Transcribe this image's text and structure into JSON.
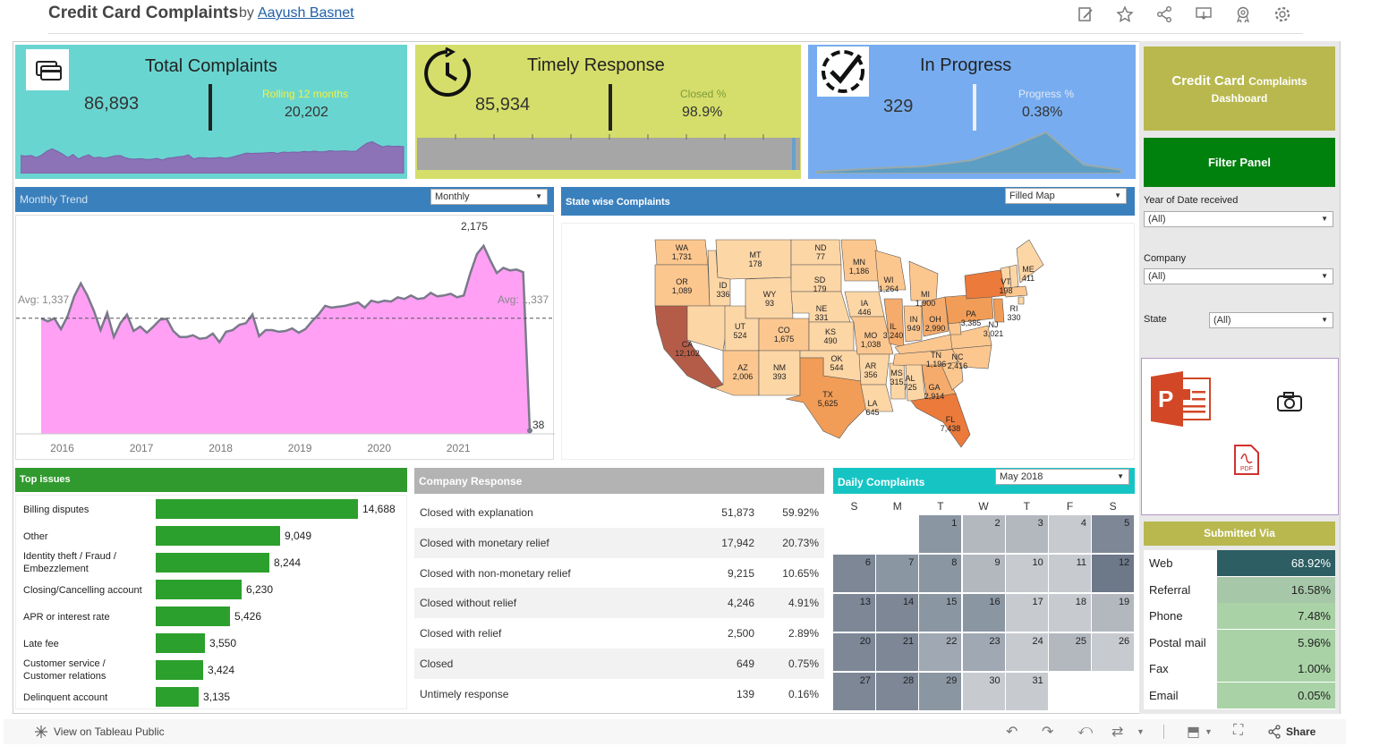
{
  "header": {
    "title": "Credit Card Complaints",
    "by": "by",
    "author": "Aayush Basnet",
    "icons": [
      "edit-icon",
      "star-icon",
      "share-icon",
      "comment-icon",
      "badge-icon",
      "gear-icon"
    ]
  },
  "kpis": {
    "total": {
      "title": "Total Complaints",
      "value": "86,893",
      "sub_label": "Rolling 12 months",
      "sub_value": "20,202",
      "bg": "#69d5d0",
      "spark_color": "#8c72b7"
    },
    "timely": {
      "title": "Timely  Response",
      "value": "85,934",
      "sub_label": "Closed %",
      "sub_value": "98.9%",
      "bg": "#d5de6a",
      "progress": 0.989
    },
    "progress": {
      "title": "In Progress",
      "value": "329",
      "sub_label": "Progress %",
      "sub_value": "0.38%",
      "bg": "#77adf0"
    }
  },
  "sidebar": {
    "title_line1": "Credit Card",
    "title_line1b": "Complaints",
    "title_line2": "Dashboard",
    "filter_panel": "Filter Panel",
    "filters": [
      {
        "label": "Year of Date received",
        "value": "(All)"
      },
      {
        "label": "Company",
        "value": "(All)"
      },
      {
        "label": "State",
        "value": "(All)"
      }
    ],
    "submitted_via_title": "Submitted Via",
    "submitted_via": [
      {
        "label": "Web",
        "value": "68.92%",
        "color": "#2c5e63",
        "text_color": "#ffffff"
      },
      {
        "label": "Referral",
        "value": "16.58%",
        "color": "#a6c7a8",
        "text_color": "#222222"
      },
      {
        "label": "Phone",
        "value": "7.48%",
        "color": "#a9d3a6",
        "text_color": "#222222"
      },
      {
        "label": "Postal mail",
        "value": "5.96%",
        "color": "#a9d3a6",
        "text_color": "#222222"
      },
      {
        "label": "Fax",
        "value": "1.00%",
        "color": "#a9d3a6",
        "text_color": "#222222"
      },
      {
        "label": "Email",
        "value": "0.05%",
        "color": "#a9d3a6",
        "text_color": "#222222"
      }
    ],
    "export_icons": [
      "powerpoint-icon",
      "camera-icon",
      "pdf-icon"
    ],
    "pdf_label": "PDF"
  },
  "monthly": {
    "title": "Monthly Trend",
    "dropdown": "Monthly",
    "avg_label_left": "Avg: 1,337",
    "avg_label_right": "Avg: 1,337",
    "peak_label": "2,175",
    "last_label": "38",
    "years": [
      "2016",
      "2017",
      "2018",
      "2019",
      "2020",
      "2021"
    ]
  },
  "chart_data": {
    "type": "area",
    "title": "Monthly Trend",
    "x_start": "2015-09",
    "values": [
      1337,
      1300,
      1336,
      1210,
      1360,
      1590,
      1740,
      1600,
      1420,
      1200,
      1400,
      1120,
      1280,
      1380,
      1190,
      1240,
      1170,
      1240,
      1320,
      1330,
      1190,
      1120,
      1120,
      1140,
      1100,
      1110,
      1160,
      1060,
      1180,
      1200,
      1260,
      1280,
      1380,
      1130,
      1200,
      1200,
      1180,
      1190,
      1220,
      1170,
      1210,
      1300,
      1380,
      1480,
      1460,
      1470,
      1480,
      1500,
      1520,
      1460,
      1540,
      1520,
      1540,
      1530,
      1580,
      1560,
      1600,
      1560,
      1570,
      1630,
      1590,
      1600,
      1620,
      1580,
      1600,
      1860,
      2080,
      2175,
      2010,
      1860,
      1920,
      1890,
      1900,
      1870,
      38
    ],
    "avg": 1337,
    "ylim": [
      0,
      2400
    ],
    "year_ticks": [
      "2016",
      "2017",
      "2018",
      "2019",
      "2020",
      "2021"
    ]
  },
  "state_map": {
    "title": "State wise Complaints",
    "dropdown": "Filled Map",
    "states": [
      {
        "code": "WA",
        "value": "1,731"
      },
      {
        "code": "OR",
        "value": "1,089"
      },
      {
        "code": "CA",
        "value": "12,102"
      },
      {
        "code": "MT",
        "value": "178"
      },
      {
        "code": "ID",
        "value": "336"
      },
      {
        "code": "WY",
        "value": "93"
      },
      {
        "code": "UT",
        "value": "524"
      },
      {
        "code": "CO",
        "value": "1,675"
      },
      {
        "code": "AZ",
        "value": "2,006"
      },
      {
        "code": "NM",
        "value": "393"
      },
      {
        "code": "ND",
        "value": "77"
      },
      {
        "code": "SD",
        "value": "179"
      },
      {
        "code": "NE",
        "value": "331"
      },
      {
        "code": "KS",
        "value": "490"
      },
      {
        "code": "OK",
        "value": "544"
      },
      {
        "code": "TX",
        "value": "5,625"
      },
      {
        "code": "MN",
        "value": "1,186"
      },
      {
        "code": "IA",
        "value": "446"
      },
      {
        "code": "MO",
        "value": "1,038"
      },
      {
        "code": "AR",
        "value": "356"
      },
      {
        "code": "LA",
        "value": "645"
      },
      {
        "code": "WI",
        "value": "1,264"
      },
      {
        "code": "IL",
        "value": "3,240"
      },
      {
        "code": "MS",
        "value": "315"
      },
      {
        "code": "MI",
        "value": "1,900"
      },
      {
        "code": "IN",
        "value": "949"
      },
      {
        "code": "OH",
        "value": "2,990"
      },
      {
        "code": "TN",
        "value": "1,196"
      },
      {
        "code": "AL",
        "value": "725"
      },
      {
        "code": "GA",
        "value": "2,914"
      },
      {
        "code": "FL",
        "value": "7,438"
      },
      {
        "code": "NC",
        "value": "2,416"
      },
      {
        "code": "PA",
        "value": "3,385"
      },
      {
        "code": "NJ",
        "value": "3,021"
      },
      {
        "code": "VT",
        "value": "198"
      },
      {
        "code": "ME",
        "value": "411"
      },
      {
        "code": "RI",
        "value": "330"
      }
    ]
  },
  "top_issues": {
    "title": "Top issues",
    "items": [
      {
        "label": "Billing disputes",
        "value": 14688,
        "text": "14,688"
      },
      {
        "label": "Other",
        "value": 9049,
        "text": "9,049"
      },
      {
        "label": "Identity theft / Fraud / Embezzlement",
        "value": 8244,
        "text": "8,244"
      },
      {
        "label": "Closing/Cancelling account",
        "value": 6230,
        "text": "6,230"
      },
      {
        "label": "APR or interest rate",
        "value": 5426,
        "text": "5,426"
      },
      {
        "label": "Late fee",
        "value": 3550,
        "text": "3,550"
      },
      {
        "label": "Customer service / Customer relations",
        "value": 3424,
        "text": "3,424"
      },
      {
        "label": "Delinquent account",
        "value": 3135,
        "text": "3,135"
      }
    ]
  },
  "company_response": {
    "title": "Company  Response",
    "rows": [
      {
        "label": "Closed with explanation",
        "count": "51,873",
        "pct": "59.92%"
      },
      {
        "label": "Closed with monetary relief",
        "count": "17,942",
        "pct": "20.73%"
      },
      {
        "label": "Closed with non-monetary relief",
        "count": "9,215",
        "pct": "10.65%"
      },
      {
        "label": "Closed without relief",
        "count": "4,246",
        "pct": "4.91%"
      },
      {
        "label": "Closed with relief",
        "count": "2,500",
        "pct": "2.89%"
      },
      {
        "label": "Closed",
        "count": "649",
        "pct": "0.75%"
      },
      {
        "label": "Untimely response",
        "count": "139",
        "pct": "0.16%"
      }
    ]
  },
  "daily": {
    "title": "Daily Complaints",
    "dropdown": "May 2018",
    "dow": [
      "S",
      "M",
      "T",
      "W",
      "T",
      "F",
      "S"
    ],
    "first_weekday": 2,
    "shades": [
      "#8b96a3",
      "#b3b8bf",
      "#b3b8bf",
      "#c7cacf",
      "#7d8796",
      "#7d8796",
      "#8b96a3",
      "#8b96a3",
      "#b3b8bf",
      "#c7cacf",
      "#c7cacf",
      "#6d7889",
      "#7d8796",
      "#7d8796",
      "#8b96a3",
      "#8b96a3",
      "#c7cacf",
      "#c7cacf",
      "#b3b8bf",
      "#7d8796",
      "#7d8796",
      "#a0a8b3",
      "#a0a8b3",
      "#c7cacf",
      "#b3b8bf",
      "#c7cacf",
      "#7d8796",
      "#7d8796",
      "#8b96a3",
      "#c7cacf",
      "#c7cacf"
    ]
  },
  "footer": {
    "view_on": "View on Tableau Public",
    "share": "Share"
  }
}
